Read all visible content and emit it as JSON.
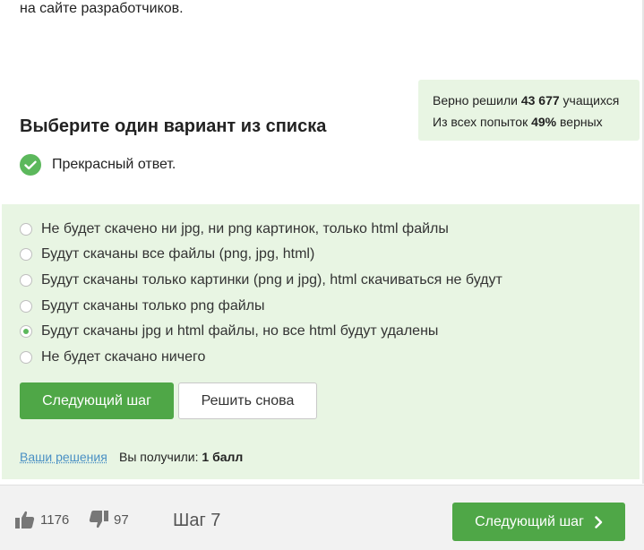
{
  "intro": {
    "text_tail": "на сайте разработчиков."
  },
  "stats": {
    "line1_prefix": "Верно решили",
    "solved_count": "43 677",
    "line1_suffix": "учащихся",
    "line2_prefix": "Из всех попыток",
    "correct_percent": "49%",
    "line2_suffix": "верных"
  },
  "question": {
    "title": "Выберите один вариант из списка",
    "feedback": "Прекрасный ответ.",
    "options": [
      {
        "label": "Не будет скачено ни jpg, ни png картинок, только html файлы",
        "selected": false
      },
      {
        "label": "Будут скачаны все файлы (png, jpg, html)",
        "selected": false
      },
      {
        "label": "Будут скачаны только картинки (png и jpg), html скачиваться не будут",
        "selected": false
      },
      {
        "label": "Будут скачаны только png файлы",
        "selected": false
      },
      {
        "label": "Будут скачаны jpg и html файлы, но все html будут удалены",
        "selected": true
      },
      {
        "label": "Не будет скачано ничего",
        "selected": false
      }
    ],
    "next_button": "Следующий шаг",
    "retry_button": "Решить снова",
    "solutions_link": "Ваши решения",
    "score_prefix": "Вы получили:",
    "score_value": "1 балл"
  },
  "footer": {
    "likes": "1176",
    "dislikes": "97",
    "step": "Шаг 7",
    "next_button": "Следующий шаг",
    "icons": {
      "like": "thumbs-up-icon",
      "dislike": "thumbs-down-icon",
      "next": "chevron-right-icon",
      "check": "check-circle-icon"
    }
  },
  "colors": {
    "accent": "#4fa747",
    "panel": "#e8f5e3",
    "link": "#4a90c4"
  }
}
